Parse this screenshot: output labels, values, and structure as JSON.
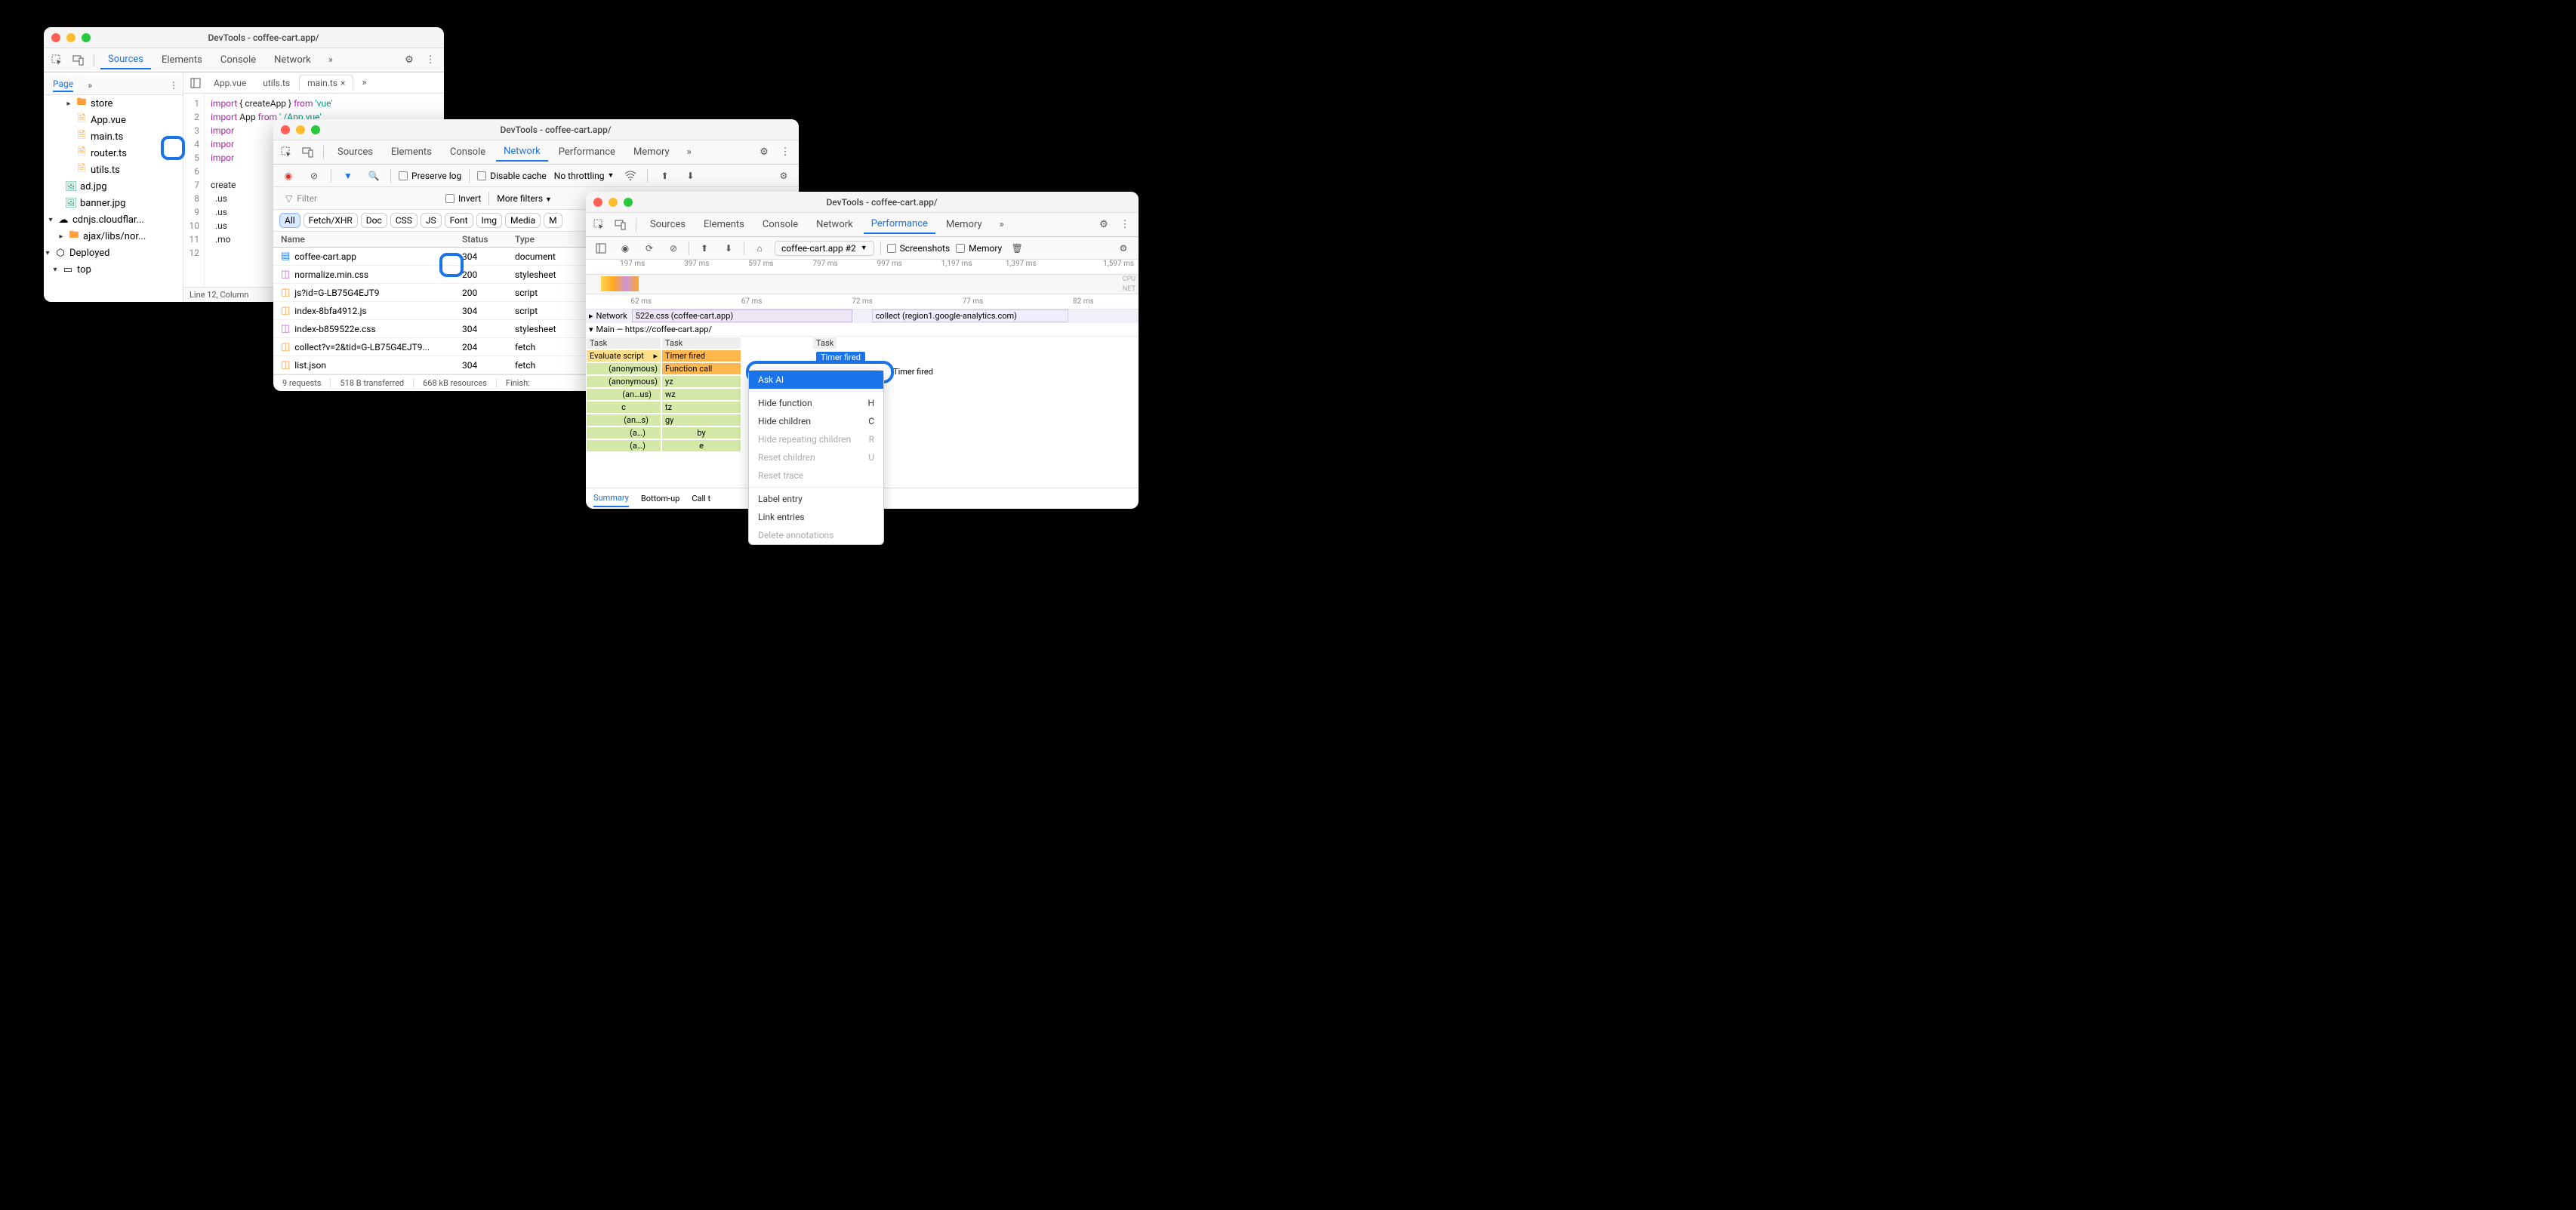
{
  "w1": {
    "title": "DevTools - coffee-cart.app/",
    "tabs": [
      "Sources",
      "Elements",
      "Console",
      "Network"
    ],
    "active_tab": "Sources",
    "nav_page": "Page",
    "tree": {
      "store": "store",
      "app_vue": "App.vue",
      "main_ts": "main.ts",
      "router": "router.ts",
      "utils": "utils.ts",
      "ad": "ad.jpg",
      "banner": "banner.jpg",
      "cdn": "cdnjs.cloudflar...",
      "ajax": "ajax/libs/nor...",
      "deployed": "Deployed",
      "top": "top"
    },
    "file_tabs": {
      "app": "App.vue",
      "utils": "utils.ts",
      "main": "main.ts"
    },
    "code_lines": [
      "1",
      "2",
      "3",
      "4",
      "5",
      "6",
      "7",
      "8",
      "9",
      "10",
      "11",
      "12"
    ],
    "code": {
      "l1": "import { createApp } from 'vue'",
      "l2": "import App from './App.vue'",
      "l3": "impor",
      "l4": "impor",
      "l5": "impor",
      "l7": "create",
      "l8": "  .us",
      "l9": "  .us",
      "l10": "  .us",
      "l11": "  .mo"
    },
    "status": "Line 12, Column"
  },
  "w2": {
    "title": "DevTools - coffee-cart.app/",
    "tabs": [
      "Sources",
      "Elements",
      "Console",
      "Network",
      "Performance",
      "Memory"
    ],
    "active_tab": "Network",
    "toolbar": {
      "preserve": "Preserve log",
      "disable": "Disable cache",
      "throttle": "No throttling"
    },
    "filter_row": {
      "filter": "Filter",
      "invert": "Invert",
      "more": "More filters"
    },
    "chips": [
      "All",
      "Fetch/XHR",
      "Doc",
      "CSS",
      "JS",
      "Font",
      "Img",
      "Media",
      "M"
    ],
    "cols": {
      "name": "Name",
      "status": "Status",
      "type": "Type"
    },
    "rows": [
      {
        "icon": "doc",
        "name": "coffee-cart.app",
        "status": "304",
        "type": "document"
      },
      {
        "icon": "css",
        "name": "normalize.min.css",
        "status": "200",
        "type": "stylesheet"
      },
      {
        "icon": "js",
        "name": "js?id=G-LB75G4EJT9",
        "status": "200",
        "type": "script"
      },
      {
        "icon": "js",
        "name": "index-8bfa4912.js",
        "status": "304",
        "type": "script"
      },
      {
        "icon": "css",
        "name": "index-b859522e.css",
        "status": "304",
        "type": "stylesheet"
      },
      {
        "icon": "js",
        "name": "collect?v=2&tid=G-LB75G4EJT9...",
        "status": "204",
        "type": "fetch"
      },
      {
        "icon": "js",
        "name": "list.json",
        "status": "304",
        "type": "fetch"
      }
    ],
    "status": {
      "req": "9 requests",
      "xfer": "518 B transferred",
      "res": "668 kB resources",
      "fin": "Finish:"
    }
  },
  "w3": {
    "title": "DevTools - coffee-cart.app/",
    "tabs": [
      "Sources",
      "Elements",
      "Console",
      "Network",
      "Performance",
      "Memory"
    ],
    "active_tab": "Performance",
    "toolbar": {
      "file": "coffee-cart.app #2",
      "screenshots": "Screenshots",
      "memory": "Memory"
    },
    "ruler1": [
      "197 ms",
      "397 ms",
      "597 ms",
      "797 ms",
      "997 ms",
      "1,197 ms",
      "1,397 ms",
      "1,597 ms"
    ],
    "cpu": "CPU",
    "net": "NET",
    "ruler2": [
      "62 ms",
      "67 ms",
      "72 ms",
      "77 ms",
      "82 ms"
    ],
    "network_track_label": "Network",
    "net_bar1": "522e.css (coffee-cart.app)",
    "net_bar2": "collect (region1.google-analytics.com)",
    "main_label": "Main — https://coffee-cart.app/",
    "task": "Task",
    "eval": "Evaluate script",
    "timer": "Timer fired",
    "fcall": "Function call",
    "anon": "(anonymous)",
    "anus": "(an…us)",
    "ans": "(an…s)",
    "a": "(a…)",
    "c": "c",
    "yz": "yz",
    "wz": "wz",
    "tz": "tz",
    "gy": "gy",
    "by": "by",
    "e": "e",
    "bottom_tabs": {
      "summary": "Summary",
      "bottomup": "Bottom-up",
      "calltree": "Call t"
    },
    "ctx": {
      "askai": "Ask AI",
      "hidefn": "Hide function",
      "hidefn_k": "H",
      "hidech": "Hide children",
      "hidech_k": "C",
      "hiderep": "Hide repeating children",
      "hiderep_k": "R",
      "reset": "Reset children",
      "reset_k": "U",
      "resettrace": "Reset trace",
      "label": "Label entry",
      "link": "Link entries",
      "delann": "Delete annotations"
    }
  }
}
